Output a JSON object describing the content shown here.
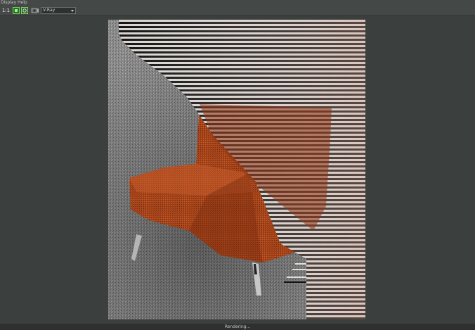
{
  "menu": {
    "items": [
      {
        "label": "Display"
      },
      {
        "label": "Help"
      }
    ]
  },
  "toolbar": {
    "ratio_label": "1:1",
    "renderer": "V-Ray",
    "icons": [
      "zoom-fit-icon",
      "region-render-icon",
      "camera-icon"
    ]
  },
  "status": {
    "text": "Rendering..."
  },
  "colors": {
    "background": "#3b3f3e",
    "accent_green": "#3a8a2c",
    "chair": "#b04a1c"
  }
}
